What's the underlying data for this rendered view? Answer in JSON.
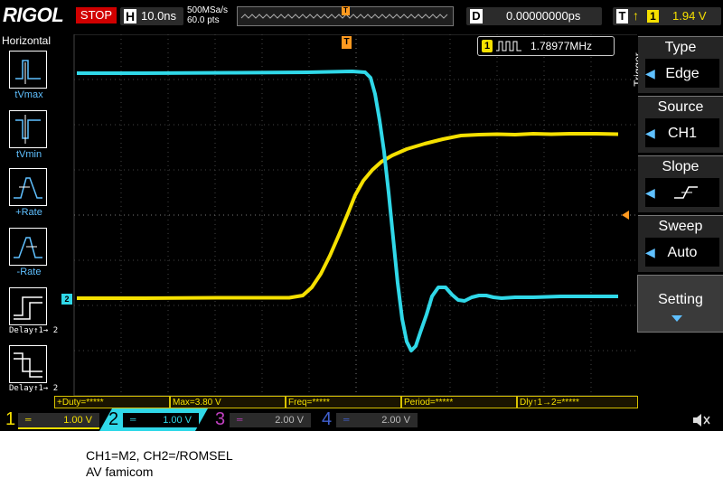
{
  "brand": "RIGOL",
  "run_status": "STOP",
  "horizontal": {
    "letter": "H",
    "timebase": "10.0ns",
    "sample_rate": "500MSa/s",
    "memory_depth": "60.0 pts",
    "trigger_pos_marker": "T"
  },
  "delay": {
    "letter": "D",
    "value": "0.00000000ps"
  },
  "trigger_header": {
    "letter": "T",
    "source": "1",
    "level": "1.94 V"
  },
  "left_menu": {
    "title": "Horizontal",
    "items": [
      {
        "label": "tVmax"
      },
      {
        "label": "tVmin"
      },
      {
        "label": "+Rate"
      },
      {
        "label": "-Rate"
      },
      {
        "label": "Delay↑1→ 2"
      },
      {
        "label": "Delay↑1→ 2"
      }
    ]
  },
  "frequency_counter": {
    "channel": "1",
    "value": "1.78977MHz"
  },
  "trigger_menu": {
    "section": "Trigger",
    "type_title": "Type",
    "type_value": "Edge",
    "source_title": "Source",
    "source_value": "CH1",
    "slope_title": "Slope",
    "sweep_title": "Sweep",
    "sweep_value": "Auto",
    "setting_title": "Setting"
  },
  "ch2_marker": "2",
  "measurements": [
    {
      "text": "+Duty=*****"
    },
    {
      "text": "Max=3.80 V"
    },
    {
      "text": "Freq=*****"
    },
    {
      "text": "Period=*****"
    },
    {
      "text": "Dly↑1→2=*****"
    }
  ],
  "channels": [
    {
      "num": "1",
      "scale": "1.00 V",
      "color": "#f5e000"
    },
    {
      "num": "2",
      "scale": "1.00 V",
      "color": "#30d8e8"
    },
    {
      "num": "3",
      "scale": "2.00 V",
      "color": "#c040c0"
    },
    {
      "num": "4",
      "scale": "2.00 V",
      "color": "#4060d0"
    }
  ],
  "caption": {
    "line1": "CH1=M2, CH2=/ROMSEL",
    "line2": "AV famicom"
  },
  "colors": {
    "ch1": "#f5e000",
    "ch2": "#30d8e8",
    "trigger": "#ff9a20",
    "ui_blue": "#5fc0ff",
    "stop_red": "#d00000"
  }
}
